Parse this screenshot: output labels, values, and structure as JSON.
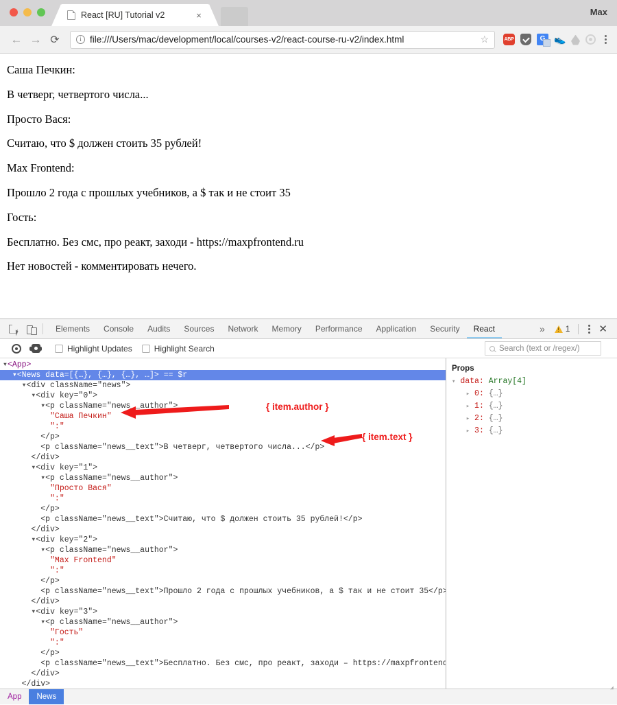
{
  "browser": {
    "tab_title": "React [RU] Tutorial v2",
    "tab_close": "×",
    "profile_name": "Max",
    "back_icon": "←",
    "forward_icon": "→",
    "reload_icon": "⟳",
    "info_icon": "i",
    "url": "file:///Users/mac/development/local/courses-v2/react-course-ru-v2/index.html",
    "star_icon": "☆",
    "extensions": [
      "ABP",
      "shield-icon",
      "G",
      "shoe-icon",
      "drop-icon",
      "circle-icon"
    ],
    "abp_label": "ABP",
    "gt_label": "G",
    "shoe_glyph": "👟"
  },
  "page": {
    "lines": [
      "Саша Печкин:",
      "В четверг, четвертого числа...",
      "Просто Вася:",
      "Считаю, что $ должен стоить 35 рублей!",
      "Max Frontend:",
      "Прошло 2 года с прошлых учебников, а $ так и не стоит 35",
      "Гость:",
      "Бесплатно. Без смс, про реакт, заходи - https://maxpfrontend.ru",
      "Нет новостей - комментировать нечего."
    ]
  },
  "devtools": {
    "tabs": [
      {
        "label": "Elements",
        "active": false
      },
      {
        "label": "Console",
        "active": false
      },
      {
        "label": "Audits",
        "active": false
      },
      {
        "label": "Sources",
        "active": false
      },
      {
        "label": "Network",
        "active": false
      },
      {
        "label": "Memory",
        "active": false
      },
      {
        "label": "Performance",
        "active": false
      },
      {
        "label": "Application",
        "active": false
      },
      {
        "label": "Security",
        "active": false
      },
      {
        "label": "React",
        "active": true
      }
    ],
    "more_icon": "»",
    "warning_count": "1",
    "close_icon": "✕",
    "react_toolbar": {
      "highlight_updates_label": "Highlight Updates",
      "highlight_updates_checked": false,
      "highlight_search_label": "Highlight Search",
      "highlight_search_checked": false,
      "search_placeholder": "Search (text or /regex/)",
      "search_value": ""
    },
    "props": {
      "title": "Props",
      "root_key": "data:",
      "root_value": "Array[4]",
      "items": [
        {
          "index": "0:",
          "value": "{…}"
        },
        {
          "index": "1:",
          "value": "{…}"
        },
        {
          "index": "2:",
          "value": "{…}"
        },
        {
          "index": "3:",
          "value": "{…}"
        }
      ]
    },
    "breadcrumbs": [
      {
        "label": "App",
        "active": false
      },
      {
        "label": "News",
        "active": true
      }
    ],
    "annotations": [
      {
        "text": "{ item.author }"
      },
      {
        "text": "{ item.text }"
      }
    ],
    "tree": {
      "app_tag": "<App>",
      "news_tag": "<News data=[{…}, {…}, {…}, …]>",
      "news_ref": "== $r",
      "div_news_open": "<div className=\"news\">",
      "close_p": "</p>",
      "close_div": "</div>",
      "colon_string": "\":\"",
      "items": [
        {
          "key": "<div key=\"0\">",
          "author_p_open": "<p className=\"news__author\">",
          "author": "\"Саша Печкин\"",
          "text_p_open": "<p className=\"news__text\">",
          "text": "В четверг, четвертого числа...",
          "text_p_close": "</p>"
        },
        {
          "key": "<div key=\"1\">",
          "author_p_open": "<p className=\"news__author\">",
          "author": "\"Просто Вася\"",
          "text_p_open": "<p className=\"news__text\">",
          "text": "Считаю, что $ должен стоить 35 рублей!",
          "text_p_close": "</p>"
        },
        {
          "key": "<div key=\"2\">",
          "author_p_open": "<p className=\"news__author\">",
          "author": "\"Max Frontend\"",
          "text_p_open": "<p className=\"news__text\">",
          "text": "Прошло 2 года с прошлых учебников, а $ так и не стоит 35",
          "text_p_close": "</p>"
        },
        {
          "key": "<div key=\"3\">",
          "author_p_open": "<p className=\"news__author\">",
          "author": "\"Гость\"",
          "text_p_open": "<p className=\"news__text\">",
          "text": "Бесплатно. Без смс, про реакт, заходи – https://maxpfrontend.ru<",
          "text_p_close": ""
        }
      ],
      "final_close_div": "</div>"
    }
  },
  "colors": {
    "selection_blue": "#6387e8",
    "annotation_red": "#ee1b1b",
    "react_tab_underline": "#8fcbf0",
    "breadcrumb_active": "#4a7fe0"
  }
}
